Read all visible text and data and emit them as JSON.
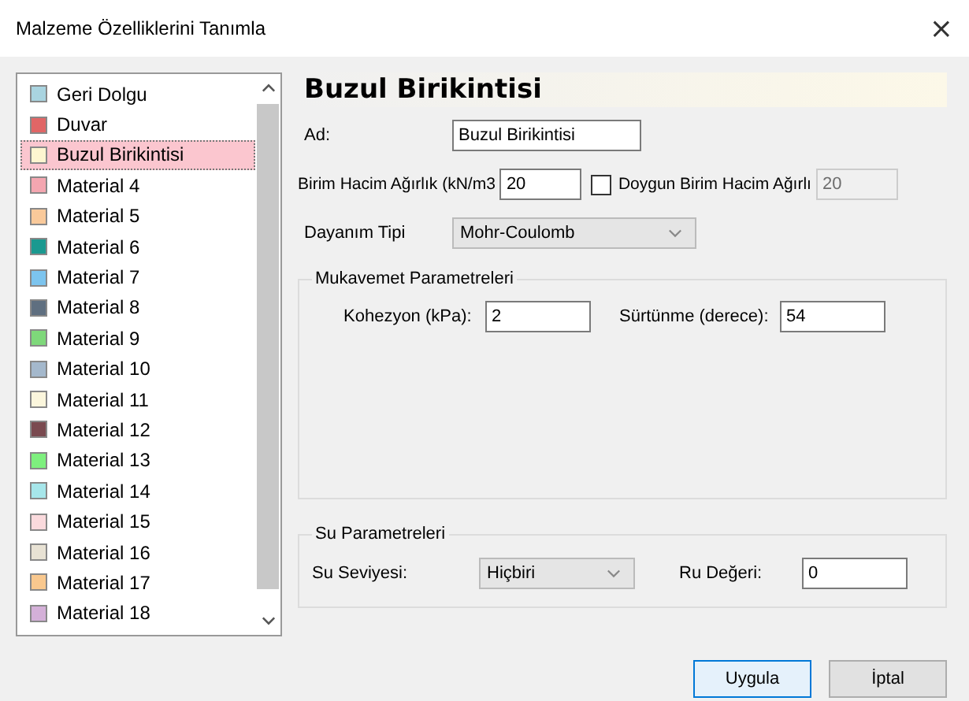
{
  "window": {
    "title": "Malzeme Özelliklerini Tanımla",
    "close": "×"
  },
  "materials": [
    {
      "name": "Geri Dolgu",
      "color": "#a9d4e0",
      "selected": false
    },
    {
      "name": "Duvar",
      "color": "#e06666",
      "selected": false
    },
    {
      "name": "Buzul Birikintisi",
      "color": "#fdf6d0",
      "selected": true
    },
    {
      "name": "Material 4",
      "color": "#f4a6b0",
      "selected": false
    },
    {
      "name": "Material 5",
      "color": "#f9c99a",
      "selected": false
    },
    {
      "name": "Material 6",
      "color": "#1a9990",
      "selected": false
    },
    {
      "name": "Material 7",
      "color": "#7cc4ee",
      "selected": false
    },
    {
      "name": "Material 8",
      "color": "#5f6f80",
      "selected": false
    },
    {
      "name": "Material 9",
      "color": "#7ed87a",
      "selected": false
    },
    {
      "name": "Material 10",
      "color": "#a4b8cc",
      "selected": false
    },
    {
      "name": "Material 11",
      "color": "#fbf6dc",
      "selected": false
    },
    {
      "name": "Material 12",
      "color": "#7a4a50",
      "selected": false
    },
    {
      "name": "Material 13",
      "color": "#7ef07e",
      "selected": false
    },
    {
      "name": "Material 14",
      "color": "#a6e6ea",
      "selected": false
    },
    {
      "name": "Material 15",
      "color": "#fadadd",
      "selected": false
    },
    {
      "name": "Material 16",
      "color": "#e8e2d4",
      "selected": false
    },
    {
      "name": "Material 17",
      "color": "#f9c88e",
      "selected": false
    },
    {
      "name": "Material 18",
      "color": "#d4b0d8",
      "selected": false
    }
  ],
  "heading": "Buzul Birikintisi",
  "name_field": {
    "label": "Ad:",
    "value": "Buzul Birikintisi"
  },
  "unit_weight": {
    "label": "Birim Hacim Ağırlık (kN/m3",
    "value": "20"
  },
  "saturated": {
    "label": "Doygun Birim Hacim Ağırlı",
    "checked": false,
    "value": "20",
    "disabled": true
  },
  "strength_type": {
    "label": "Dayanım Tipi",
    "value": "Mohr-Coulomb"
  },
  "strength_group": {
    "title": "Mukavemet Parametreleri",
    "cohesion_label": "Kohezyon (kPa):",
    "cohesion": "2",
    "friction_label": "Sürtünme (derece):",
    "friction": "54"
  },
  "water_group": {
    "title": "Su Parametreleri",
    "level_label": "Su Seviyesi:",
    "level": "Hiçbiri",
    "ru_label": "Ru Değeri:",
    "ru": "0"
  },
  "buttons": [
    {
      "label": "Uygula",
      "default": true
    },
    {
      "label": "İptal",
      "default": false
    }
  ]
}
